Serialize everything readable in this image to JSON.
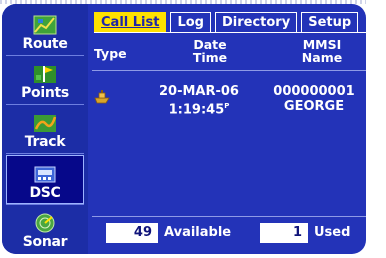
{
  "sidebar": {
    "items": [
      {
        "label": "Route",
        "icon": "route-map-icon"
      },
      {
        "label": "Points",
        "icon": "points-flag-icon"
      },
      {
        "label": "Track",
        "icon": "track-icon"
      },
      {
        "label": "DSC",
        "icon": "dsc-radio-icon"
      },
      {
        "label": "Sonar",
        "icon": "sonar-icon"
      }
    ],
    "active": "DSC"
  },
  "tabs": [
    {
      "label": "Call List",
      "active": true
    },
    {
      "label": "Log",
      "active": false
    },
    {
      "label": "Directory",
      "active": false
    },
    {
      "label": "Setup",
      "active": false
    }
  ],
  "columns": {
    "type": "Type",
    "date_line1": "Date",
    "date_line2": "Time",
    "mmsi_line1": "MMSI",
    "mmsi_line2": "Name"
  },
  "rows": [
    {
      "type_icon": "boat-icon",
      "date": "20-MAR-06",
      "time": "1:19:45",
      "time_suffix": "P",
      "mmsi": "000000001",
      "name": "GEORGE"
    }
  ],
  "footer": {
    "available_count": "49",
    "available_label": "Available",
    "used_count": "1",
    "used_label": "Used"
  },
  "colors": {
    "background": "#2333b8",
    "active_tab": "#ffe100",
    "text": "#ffffff"
  }
}
